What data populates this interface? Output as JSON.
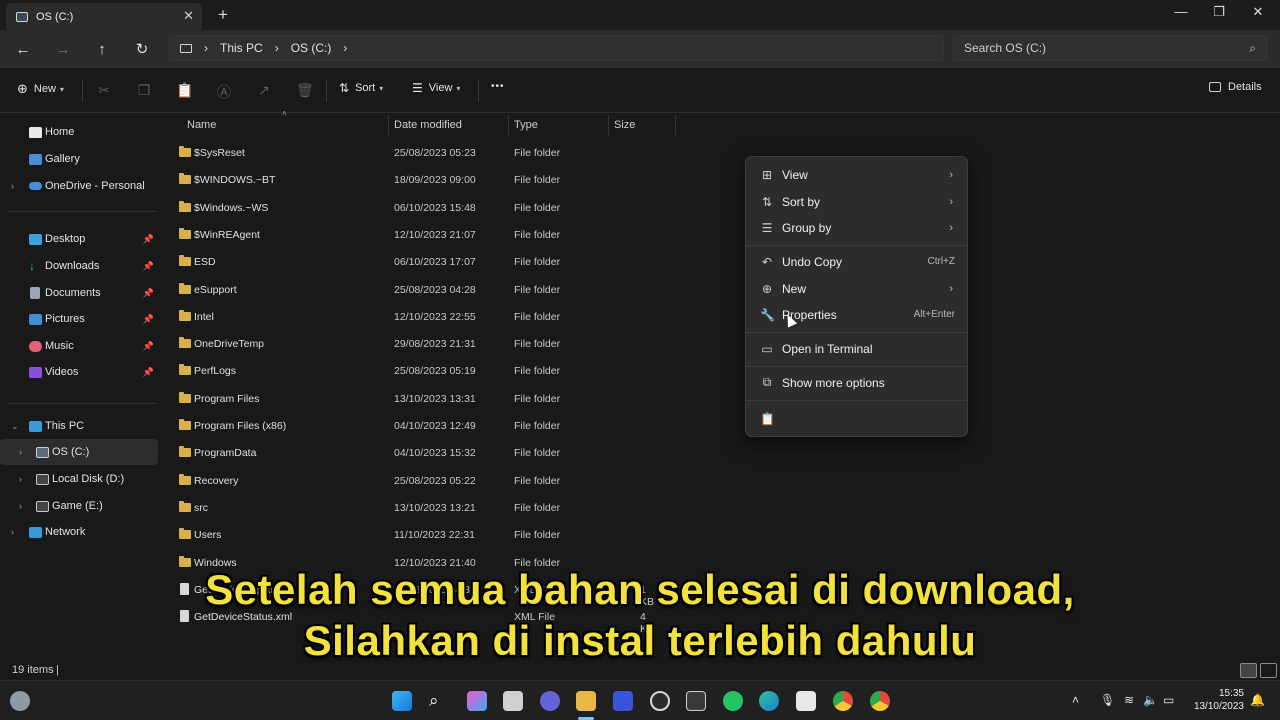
{
  "tab": {
    "title": "OS (C:)",
    "close": "✕",
    "new": "+"
  },
  "window": {
    "minimize": "—",
    "maximize": "❐",
    "close": "✕"
  },
  "breadcrumb": {
    "root": "This PC",
    "drive": "OS (C:)"
  },
  "search": {
    "placeholder": "Search OS (C:)"
  },
  "commands": {
    "new": "New",
    "sort": "Sort",
    "view": "View",
    "more": "•••",
    "details": "Details"
  },
  "sidebar": {
    "home": "Home",
    "gallery": "Gallery",
    "onedrive": "OneDrive - Personal",
    "quick": [
      "Desktop",
      "Downloads",
      "Documents",
      "Pictures",
      "Music",
      "Videos"
    ],
    "thispc": "This PC",
    "drives": [
      "OS (C:)",
      "Local Disk (D:)",
      "Game (E:)"
    ],
    "network": "Network"
  },
  "columns": {
    "name": "Name",
    "date": "Date modified",
    "type": "Type",
    "size": "Size"
  },
  "files": [
    {
      "name": "$SysReset",
      "date": "25/08/2023 05:23",
      "type": "File folder",
      "size": ""
    },
    {
      "name": "$WINDOWS.~BT",
      "date": "18/09/2023 09:00",
      "type": "File folder",
      "size": ""
    },
    {
      "name": "$Windows.~WS",
      "date": "06/10/2023 15:48",
      "type": "File folder",
      "size": ""
    },
    {
      "name": "$WinREAgent",
      "date": "12/10/2023 21:07",
      "type": "File folder",
      "size": ""
    },
    {
      "name": "ESD",
      "date": "06/10/2023 17:07",
      "type": "File folder",
      "size": ""
    },
    {
      "name": "eSupport",
      "date": "25/08/2023 04:28",
      "type": "File folder",
      "size": ""
    },
    {
      "name": "Intel",
      "date": "12/10/2023 22:55",
      "type": "File folder",
      "size": ""
    },
    {
      "name": "OneDriveTemp",
      "date": "29/08/2023 21:31",
      "type": "File folder",
      "size": ""
    },
    {
      "name": "PerfLogs",
      "date": "25/08/2023 05:19",
      "type": "File folder",
      "size": ""
    },
    {
      "name": "Program Files",
      "date": "13/10/2023 13:31",
      "type": "File folder",
      "size": ""
    },
    {
      "name": "Program Files (x86)",
      "date": "04/10/2023 12:49",
      "type": "File folder",
      "size": ""
    },
    {
      "name": "ProgramData",
      "date": "04/10/2023 15:32",
      "type": "File folder",
      "size": ""
    },
    {
      "name": "Recovery",
      "date": "25/08/2023 05:22",
      "type": "File folder",
      "size": ""
    },
    {
      "name": "src",
      "date": "13/10/2023 13:21",
      "type": "File folder",
      "size": ""
    },
    {
      "name": "Users",
      "date": "11/10/2023 22:31",
      "type": "File folder",
      "size": ""
    },
    {
      "name": "Windows",
      "date": "12/10/2023 21:40",
      "type": "File folder",
      "size": ""
    },
    {
      "name": "GetDeviceCap.xml",
      "date": "25/08/2023 04:31",
      "type": "XML File",
      "size": "1 KB"
    },
    {
      "name": "GetDeviceStatus.xml",
      "date": "",
      "type": "XML File",
      "size": "4 KB"
    }
  ],
  "context_menu": {
    "view": "View",
    "sort_by": "Sort by",
    "group_by": "Group by",
    "undo_copy": "Undo Copy",
    "undo_key": "Ctrl+Z",
    "new": "New",
    "properties": "Properties",
    "properties_key": "Alt+Enter",
    "terminal": "Open in Terminal",
    "more_options": "Show more options"
  },
  "status": {
    "items": "19 items",
    "sep": "|"
  },
  "clock": {
    "time": "15:35",
    "date": "13/10/2023"
  },
  "subtitles": {
    "line1": "Setelah semua bahan selesai di download,",
    "line2": "Silahkan di instal terlebih dahulu"
  },
  "colors": {
    "accent": "#7ac4f0",
    "folder": "#d9b04a",
    "subtitle": "#f4e23c"
  }
}
